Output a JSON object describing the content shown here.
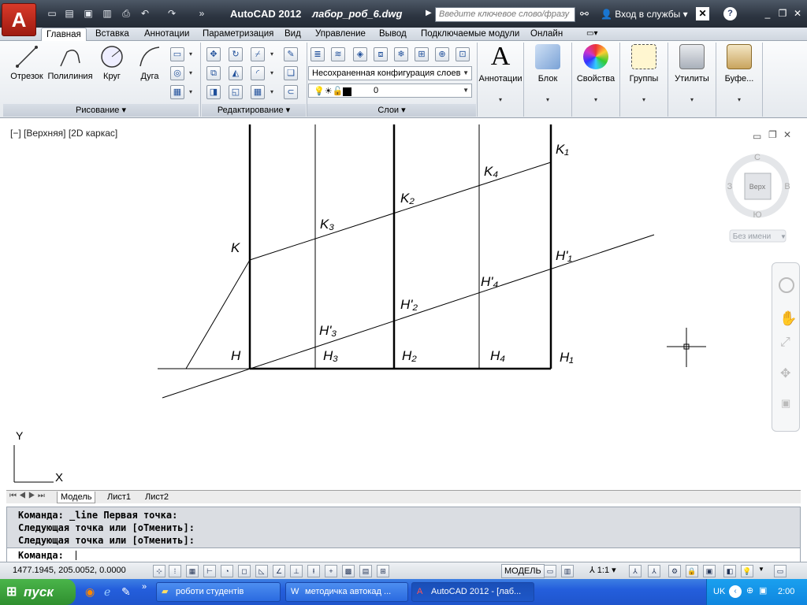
{
  "app": {
    "name": "AutoCAD 2012",
    "document": "лабор_роб_6.dwg",
    "search_placeholder": "Введите ключевое слово/фразу",
    "login": "Вход в службы"
  },
  "tabs": [
    "Главная",
    "Вставка",
    "Аннотации",
    "Параметризация",
    "Вид",
    "Управление",
    "Вывод",
    "Подключаемые модули",
    "Онлайн"
  ],
  "ribbon": {
    "draw": {
      "title": "Рисование",
      "tools": [
        "Отрезок",
        "Полилиния",
        "Круг",
        "Дуга"
      ]
    },
    "modify": {
      "title": "Редактирование"
    },
    "layers": {
      "title": "Слои",
      "config": "Несохраненная конфигурация слоев",
      "current_layer": "0"
    },
    "big": [
      "Аннотации",
      "Блок",
      "Свойства",
      "Группы",
      "Утилиты",
      "Буфе..."
    ]
  },
  "viewport": {
    "label": "[−] [Верхняя] [2D каркас]"
  },
  "viewcube": {
    "north": "С",
    "south": "Ю",
    "west": "З",
    "east": "В",
    "face": "Верх",
    "ucs_name": "Без имени"
  },
  "ucs": {
    "x": "X",
    "y": "Y"
  },
  "drawing_labels": {
    "K": "K",
    "K1": "K₁",
    "K2": "K₂",
    "K3": "K₃",
    "K4": "K₄",
    "H": "H",
    "H1": "H₁",
    "H2": "H₂",
    "H3": "H₃",
    "H4": "H₄",
    "Hp1": "H'₁",
    "Hp2": "H'₂",
    "Hp3": "H'₃",
    "Hp4": "H'₄"
  },
  "layout_tabs": [
    "Модель",
    "Лист1",
    "Лист2"
  ],
  "command_history": [
    "Команда: _line Первая точка:",
    "Следующая точка или [оТменить]:",
    "Следующая точка или [оТменить]:"
  ],
  "command_prompt": "Команда:",
  "status": {
    "coords": "1477.1945, 205.0052, 0.0000",
    "space": "МОДЕЛЬ",
    "scale": "1:1"
  },
  "taskbar": {
    "start": "пуск",
    "items": [
      "роботи студентів",
      "методичка автокад ...",
      "AutoCAD 2012 - [лаб..."
    ],
    "lang": "UK",
    "time": "2:00"
  },
  "colors": {
    "title_bg": "#2c3440",
    "accent_red": "#c62a1a",
    "taskbar": "#245edc",
    "start": "#3a9f3a"
  }
}
